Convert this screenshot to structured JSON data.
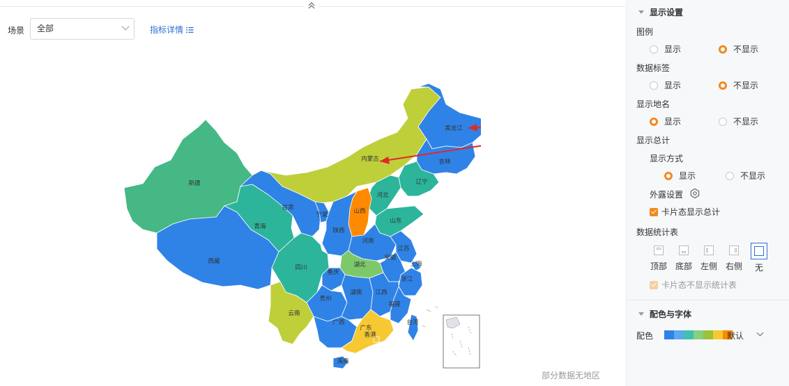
{
  "filter": {
    "scene_label": "场景",
    "scene_value": "全部",
    "metric_link": "指标详情"
  },
  "map": {
    "footnote": "部分数据无地区",
    "regions": [
      {
        "name": "新疆",
        "color": "#45b886"
      },
      {
        "name": "西藏",
        "color": "#2f83e6"
      },
      {
        "name": "青海",
        "color": "#2cb59b"
      },
      {
        "name": "甘肃",
        "color": "#2f83e6"
      },
      {
        "name": "内蒙古",
        "color": "#bfcf3a"
      },
      {
        "name": "黑龙江",
        "color": "#2f83e6"
      },
      {
        "name": "吉林",
        "color": "#2f83e6"
      },
      {
        "name": "辽宁",
        "color": "#2cb59b"
      },
      {
        "name": "河北",
        "color": "#2cb59b"
      },
      {
        "name": "山西",
        "color": "#ff8a00"
      },
      {
        "name": "宁夏",
        "color": "#2f83e6"
      },
      {
        "name": "陕西",
        "color": "#2f83e6"
      },
      {
        "name": "山东",
        "color": "#2cb59b"
      },
      {
        "name": "河南",
        "color": "#2f83e6"
      },
      {
        "name": "江苏",
        "color": "#2f83e6"
      },
      {
        "name": "安徽",
        "color": "#2f83e6"
      },
      {
        "name": "上海",
        "color": "#2f83e6"
      },
      {
        "name": "浙江",
        "color": "#2f83e6"
      },
      {
        "name": "四川",
        "color": "#2cb59b"
      },
      {
        "name": "湖北",
        "color": "#7dc96a"
      },
      {
        "name": "重庆",
        "color": "#2f83e6"
      },
      {
        "name": "贵州",
        "color": "#2f83e6"
      },
      {
        "name": "湖南",
        "color": "#2f83e6"
      },
      {
        "name": "江西",
        "color": "#2f83e6"
      },
      {
        "name": "福建",
        "color": "#2f83e6"
      },
      {
        "name": "云南",
        "color": "#bfcf3a"
      },
      {
        "name": "广西",
        "color": "#2f83e6"
      },
      {
        "name": "广东",
        "color": "#f6c933"
      },
      {
        "name": "香港",
        "color": "#f6c933"
      },
      {
        "name": "台湾",
        "color": "#2f83e6"
      },
      {
        "name": "海南",
        "color": "#2f83e6"
      }
    ]
  },
  "panel": {
    "display_settings": {
      "title": "显示设置",
      "legend": {
        "label": "图例",
        "opt_show": "显示",
        "opt_hide": "不显示",
        "selected": "不显示"
      },
      "data_label": {
        "label": "数据标签",
        "opt_show": "显示",
        "opt_hide": "不显示",
        "selected": "不显示"
      },
      "place_name": {
        "label": "显示地名",
        "opt_show": "显示",
        "opt_hide": "不显示",
        "selected": "显示"
      },
      "total": {
        "label": "显示总计",
        "mode_label": "显示方式",
        "opt_show": "显示",
        "opt_hide": "不显示",
        "selected": "显示",
        "exposure_label": "外露设置",
        "card_total_label": "卡片态显示总计"
      },
      "stats_table": {
        "label": "数据统计表",
        "options": [
          "顶部",
          "底部",
          "左侧",
          "右侧",
          "无"
        ],
        "selected": "无",
        "card_hide_label": "卡片态不显示统计表"
      }
    },
    "color_font": {
      "title": "配色与字体",
      "palette_label": "配色",
      "palette_value": "默认",
      "palette_colors": [
        "#2f83e6",
        "#5aa8f0",
        "#40c0b0",
        "#86d07e",
        "#9bc23a",
        "#f6c933",
        "#ff8a00"
      ]
    }
  }
}
